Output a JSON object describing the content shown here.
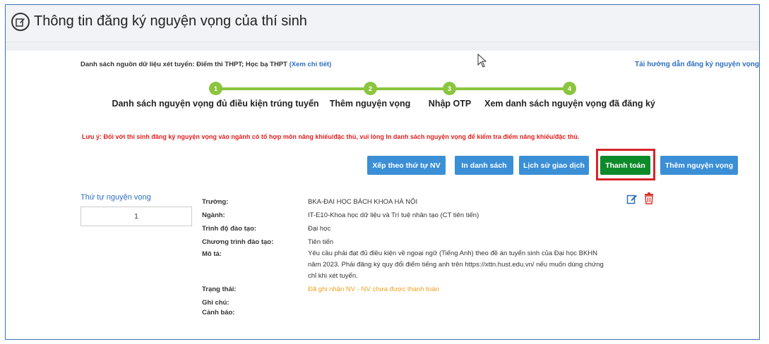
{
  "header": {
    "title": "Thông tin đăng ký nguyện vọng của thí sinh",
    "icon": "edit-circle-icon"
  },
  "source": {
    "label": "Danh sách nguồn dữ liệu xét tuyển: Điểm thi THPT; Học bạ THPT",
    "link": "(Xem chi tiết)"
  },
  "guide_link": "Tải hướng dẫn đăng ký nguyện vọng",
  "steps": [
    {
      "num": "1",
      "label": "Danh sách nguyện vọng đủ điều kiện trúng tuyển"
    },
    {
      "num": "2",
      "label": "Thêm nguyện vọng"
    },
    {
      "num": "3",
      "label": "Nhập OTP"
    },
    {
      "num": "4",
      "label": "Xem danh sách nguyện vọng đã đăng ký"
    }
  ],
  "note": "Lưu ý: Đối với thí sinh đăng ký nguyện vọng vào ngành có tổ hợp môn năng khiếu/đặc thù, vui lòng In danh sách nguyện vọng để kiểm tra điểm năng khiếu/đặc thù.",
  "buttons": {
    "sort": "Xếp theo thứ tự NV",
    "print": "In danh sách",
    "history": "Lịch sử giao dịch",
    "pay": "Thanh toán",
    "add": "Thêm nguyện vọng"
  },
  "colors": {
    "blue_button": "#3a8fd6",
    "green_button": "#0d8a2a",
    "highlight": "#d8232a",
    "step": "#8bc53f",
    "status": "#f0a020"
  },
  "order": {
    "title": "Thứ tự nguyện vọng",
    "value": "1"
  },
  "record": {
    "school_label": "Trường:",
    "school": "BKA-ĐẠI HỌC BÁCH KHOA HÀ NỘI",
    "major_label": "Ngành:",
    "major": "IT-E10-Khoa học dữ liệu và Trí tuệ nhân tạo (CT tiên tiến)",
    "level_label": "Trình độ đào tạo:",
    "level": "Đại học",
    "program_label": "Chương trình đào tạo:",
    "program": "Tiên tiến",
    "desc_label": "Mô tả:",
    "desc": "Yêu cầu phải đạt đủ điều kiện về ngoại ngữ (Tiếng Anh) theo đề án tuyển sinh của Đại học BKHN năm 2023. Phải đăng ký quy đổi điểm tiếng anh trên https://xttn.hust.edu.vn/ nếu muốn dùng chứng chỉ khi xét tuyển.",
    "status_label": "Trạng thái:",
    "status": "Đã ghi nhận NV - NV chưa được thanh toán",
    "note_label": "Ghi chú:",
    "warning_label": "Cảnh báo:"
  }
}
